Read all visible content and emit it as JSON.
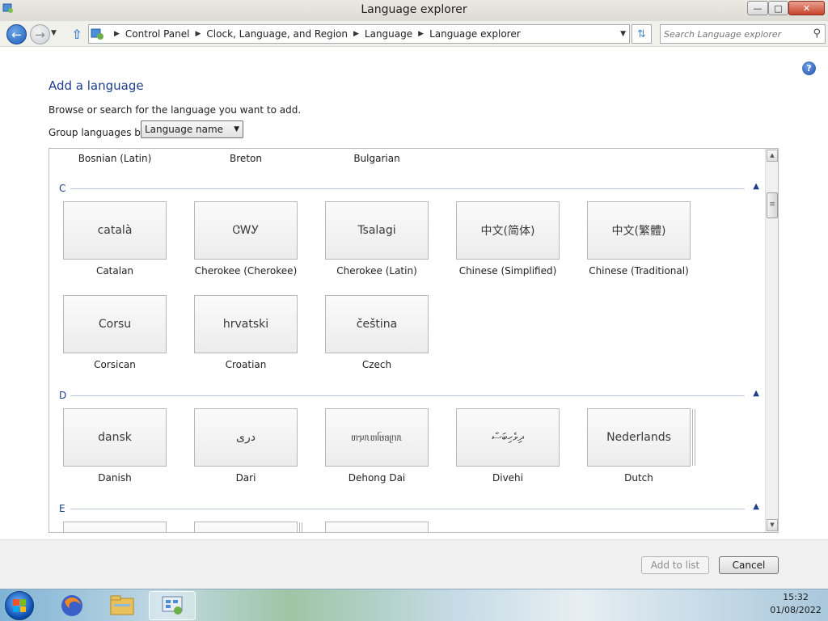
{
  "window": {
    "title": "Language explorer"
  },
  "navbar": {
    "breadcrumbs": [
      "Control Panel",
      "Clock, Language, and Region",
      "Language",
      "Language explorer"
    ],
    "search_placeholder": "Search Language explorer"
  },
  "page": {
    "heading": "Add a language",
    "description": "Browse or search for the language you want to add.",
    "group_label": "Group languages by:",
    "group_value": "Language name"
  },
  "top_row": [
    "Bosnian (Latin)",
    "Breton",
    "Bulgarian"
  ],
  "groups": [
    {
      "letter": "C",
      "tiles": [
        {
          "native": "català",
          "name": "Catalan"
        },
        {
          "native": "ᏣᎳᎩ",
          "name": "Cherokee (Cherokee)"
        },
        {
          "native": "Tsalagi",
          "name": "Cherokee (Latin)"
        },
        {
          "native": "中文(简体)",
          "name": "Chinese (Simplified)"
        },
        {
          "native": "中文(繁體)",
          "name": "Chinese (Traditional)"
        },
        {
          "native": "Corsu",
          "name": "Corsican"
        },
        {
          "native": "hrvatski",
          "name": "Croatian"
        },
        {
          "native": "čeština",
          "name": "Czech"
        }
      ]
    },
    {
      "letter": "D",
      "tiles": [
        {
          "native": "dansk",
          "name": "Danish"
        },
        {
          "native": "درى",
          "name": "Dari"
        },
        {
          "native": "ᥖᥭᥰᥖᥬᥳᥑᥨᥒᥰ",
          "name": "Dehong Dai"
        },
        {
          "native": "ދިވެހިބަސް",
          "name": "Divehi"
        },
        {
          "native": "Nederlands",
          "name": "Dutch"
        }
      ]
    },
    {
      "letter": "E",
      "tiles": []
    }
  ],
  "footer": {
    "add_label": "Add to list",
    "cancel_label": "Cancel"
  },
  "taskbar": {
    "time": "15:32",
    "date": "01/08/2022"
  }
}
